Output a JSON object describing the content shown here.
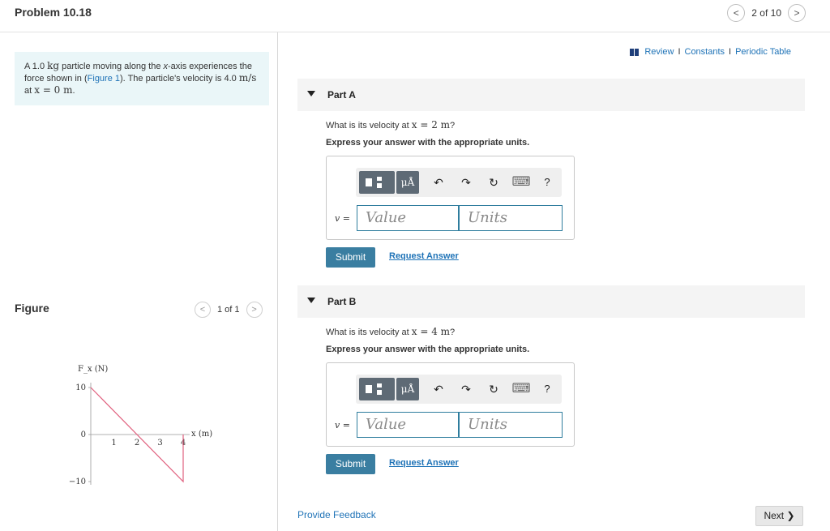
{
  "header": {
    "title": "Problem 10.18",
    "pager_text": "2 of 10",
    "prev_icon": "<",
    "next_icon": ">"
  },
  "intro": {
    "t1": "A 1.0 ",
    "m1": "kg",
    "t2": " particle moving along the ",
    "t3": "x",
    "t4": "-axis experiences the force shown in (",
    "link": "Figure 1",
    "t5": "). The particle's velocity is 4.0 ",
    "m2": "m/s",
    "t6": " at ",
    "m3": "x = 0 m",
    "t7": "."
  },
  "figure": {
    "label": "Figure",
    "pager_text": "1 of 1",
    "prev_icon": "<",
    "next_icon": ">"
  },
  "chart_data": {
    "type": "line",
    "title": "",
    "ylabel": "F_x (N)",
    "xlabel": "x (m)",
    "x": [
      0,
      4,
      4
    ],
    "y": [
      10,
      -10,
      0
    ],
    "ylim": [
      -10,
      10
    ],
    "yticks": [
      10,
      0,
      -10
    ],
    "xticks": [
      1,
      2,
      3,
      4
    ],
    "line_color": "#e0607e"
  },
  "links": {
    "review": "Review",
    "constants": "Constants",
    "periodic": "Periodic Table",
    "sep": "I"
  },
  "partA": {
    "label": "Part A",
    "q_pre": "What is its velocity at ",
    "q_math": "x = 2 m",
    "q_post": "?",
    "instruction": "Express your answer with the appropriate units.",
    "var": "v =",
    "value_placeholder": "Value",
    "units_placeholder": "Units",
    "submit": "Submit",
    "request": "Request Answer"
  },
  "partB": {
    "label": "Part B",
    "q_pre": "What is its velocity at ",
    "q_math": "x = 4 m",
    "q_post": "?",
    "instruction": "Express your answer with the appropriate units.",
    "var": "v =",
    "value_placeholder": "Value",
    "units_placeholder": "Units",
    "submit": "Submit",
    "request": "Request Answer"
  },
  "toolbar": {
    "mu": "μÅ",
    "undo": "↶",
    "redo": "↷",
    "reset": "↻",
    "keyboard": "⌨",
    "help": "?"
  },
  "footer": {
    "feedback": "Provide Feedback",
    "next": "Next ❯"
  },
  "colors": {
    "accent": "#1f73b7",
    "submit": "#3a7ea1",
    "intro_bg": "#eaf6f8"
  }
}
